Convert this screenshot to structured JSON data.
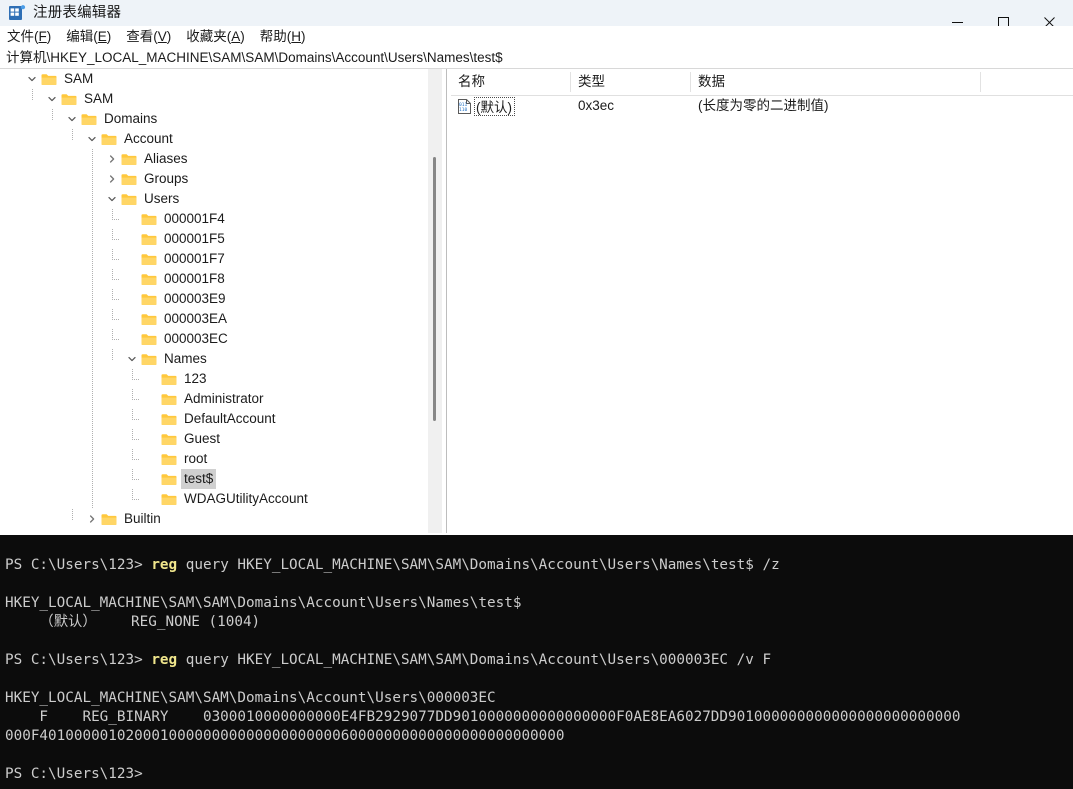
{
  "window": {
    "title": "注册表编辑器",
    "icon": "registry-editor-icon",
    "controls": {
      "minimize": "—",
      "maximize": "☐",
      "close": "✕"
    }
  },
  "menu": {
    "items": [
      {
        "label": "文件",
        "accel": "F"
      },
      {
        "label": "编辑",
        "accel": "E"
      },
      {
        "label": "查看",
        "accel": "V"
      },
      {
        "label": "收藏夹",
        "accel": "A"
      },
      {
        "label": "帮助",
        "accel": "H"
      }
    ]
  },
  "address": {
    "path": "计算机\\HKEY_LOCAL_MACHINE\\SAM\\SAM\\Domains\\Account\\Users\\Names\\test$"
  },
  "tree": {
    "nodes": [
      {
        "label": "SAM",
        "depth": 1,
        "state": "expanded",
        "selected": false
      },
      {
        "label": "SAM",
        "depth": 2,
        "state": "expanded",
        "selected": false
      },
      {
        "label": "Domains",
        "depth": 3,
        "state": "expanded",
        "selected": false
      },
      {
        "label": "Account",
        "depth": 4,
        "state": "expanded",
        "selected": false
      },
      {
        "label": "Aliases",
        "depth": 5,
        "state": "collapsed",
        "selected": false
      },
      {
        "label": "Groups",
        "depth": 5,
        "state": "collapsed",
        "selected": false
      },
      {
        "label": "Users",
        "depth": 5,
        "state": "expanded",
        "selected": false
      },
      {
        "label": "000001F4",
        "depth": 6,
        "state": "leaf",
        "selected": false
      },
      {
        "label": "000001F5",
        "depth": 6,
        "state": "leaf",
        "selected": false
      },
      {
        "label": "000001F7",
        "depth": 6,
        "state": "leaf",
        "selected": false
      },
      {
        "label": "000001F8",
        "depth": 6,
        "state": "leaf",
        "selected": false
      },
      {
        "label": "000003E9",
        "depth": 6,
        "state": "leaf",
        "selected": false
      },
      {
        "label": "000003EA",
        "depth": 6,
        "state": "leaf",
        "selected": false
      },
      {
        "label": "000003EC",
        "depth": 6,
        "state": "leaf",
        "selected": false
      },
      {
        "label": "Names",
        "depth": 6,
        "state": "expanded",
        "selected": false
      },
      {
        "label": "123",
        "depth": 7,
        "state": "leaf",
        "selected": false
      },
      {
        "label": "Administrator",
        "depth": 7,
        "state": "leaf",
        "selected": false
      },
      {
        "label": "DefaultAccount",
        "depth": 7,
        "state": "leaf",
        "selected": false
      },
      {
        "label": "Guest",
        "depth": 7,
        "state": "leaf",
        "selected": false
      },
      {
        "label": "root",
        "depth": 7,
        "state": "leaf",
        "selected": false
      },
      {
        "label": "test$",
        "depth": 7,
        "state": "leaf",
        "selected": true
      },
      {
        "label": "WDAGUtilityAccount",
        "depth": 7,
        "state": "leaf",
        "selected": false
      },
      {
        "label": "Builtin",
        "depth": 4,
        "state": "collapsed",
        "selected": false
      }
    ]
  },
  "listview": {
    "columns": [
      {
        "label": "名称"
      },
      {
        "label": "类型"
      },
      {
        "label": "数据"
      }
    ],
    "rows": [
      {
        "icon": "binary-value-icon",
        "name": "(默认)",
        "type": "0x3ec",
        "data": "(长度为零的二进制值)"
      }
    ]
  },
  "terminal": {
    "lines": [
      {
        "prompt": "PS C:\\Users\\123> ",
        "keyword": "reg",
        "rest": " query HKEY_LOCAL_MACHINE\\SAM\\SAM\\Domains\\Account\\Users\\Names\\test$ /z"
      },
      {
        "text": ""
      },
      {
        "text": "HKEY_LOCAL_MACHINE\\SAM\\SAM\\Domains\\Account\\Users\\Names\\test$"
      },
      {
        "text": "    （默认）    REG_NONE (1004)"
      },
      {
        "text": ""
      },
      {
        "prompt": "PS C:\\Users\\123> ",
        "keyword": "reg",
        "rest": " query HKEY_LOCAL_MACHINE\\SAM\\SAM\\Domains\\Account\\Users\\000003EC /v F"
      },
      {
        "text": ""
      },
      {
        "text": "HKEY_LOCAL_MACHINE\\SAM\\SAM\\Domains\\Account\\Users\\000003EC"
      },
      {
        "text": "    F    REG_BINARY    0300010000000000E4FB2929077DD9010000000000000000F0AE8EA6027DD901000000000000000000000000"
      },
      {
        "text": "000F4010000010200010000000000000000000060000000000000000000000000"
      },
      {
        "text": ""
      },
      {
        "prompt": "PS C:\\Users\\123> ",
        "keyword": "",
        "rest": ""
      }
    ]
  },
  "colors": {
    "titlebar": "#eef3f8",
    "terminal_bg": "#0c0c0c",
    "terminal_fg": "#cccccc",
    "keyword": "#f0e68c",
    "folder": "#ffc83d",
    "selection": "#d0d0d0"
  }
}
